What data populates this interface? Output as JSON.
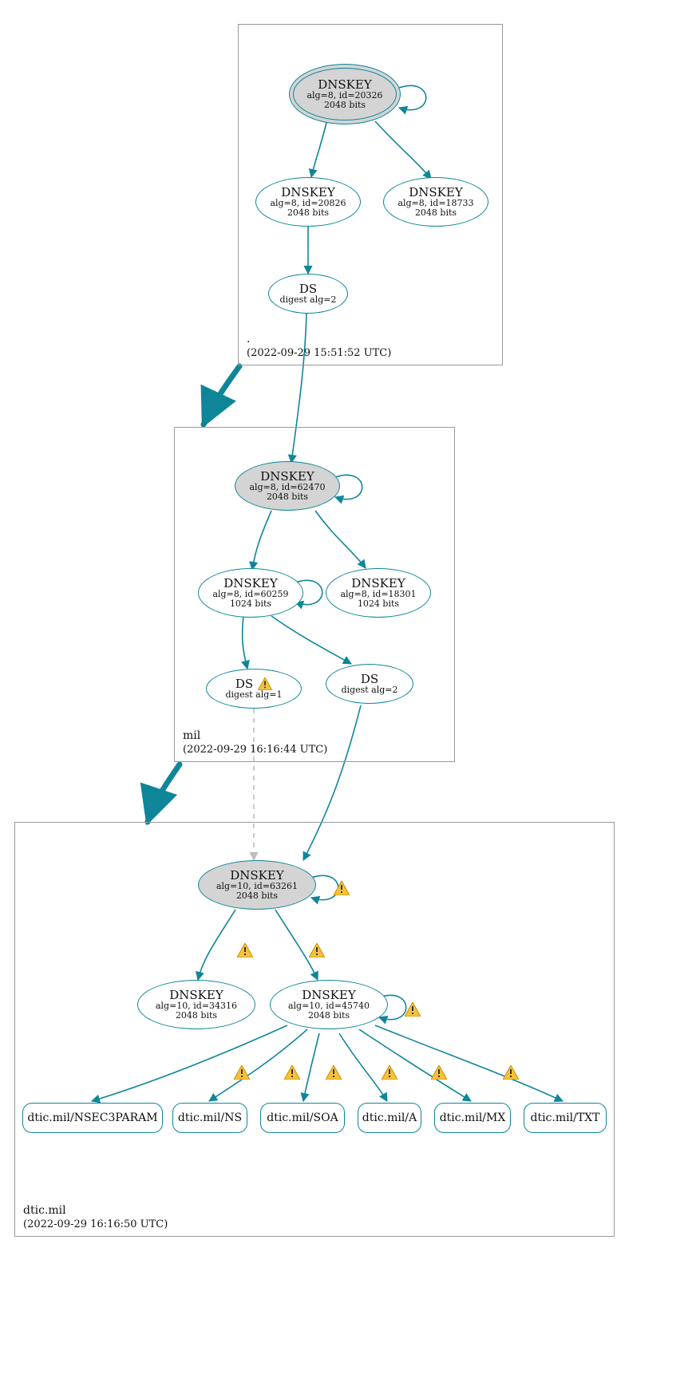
{
  "zones": {
    "root": {
      "name": ".",
      "timestamp": "(2022-09-29 15:51:52 UTC)"
    },
    "mil": {
      "name": "mil",
      "timestamp": "(2022-09-29 16:16:44 UTC)"
    },
    "dtic": {
      "name": "dtic.mil",
      "timestamp": "(2022-09-29 16:16:50 UTC)"
    }
  },
  "nodes": {
    "root_ksk": {
      "title": "DNSKEY",
      "sub1": "alg=8, id=20326",
      "sub2": "2048 bits"
    },
    "root_zsk": {
      "title": "DNSKEY",
      "sub1": "alg=8, id=20826",
      "sub2": "2048 bits"
    },
    "root_zsk2": {
      "title": "DNSKEY",
      "sub1": "alg=8, id=18733",
      "sub2": "2048 bits"
    },
    "root_ds": {
      "title": "DS",
      "sub1": "digest alg=2"
    },
    "mil_ksk": {
      "title": "DNSKEY",
      "sub1": "alg=8, id=62470",
      "sub2": "2048 bits"
    },
    "mil_zsk": {
      "title": "DNSKEY",
      "sub1": "alg=8, id=60259",
      "sub2": "1024 bits"
    },
    "mil_zsk2": {
      "title": "DNSKEY",
      "sub1": "alg=8, id=18301",
      "sub2": "1024 bits"
    },
    "mil_ds1": {
      "title": "DS",
      "sub1": "digest alg=1"
    },
    "mil_ds2": {
      "title": "DS",
      "sub1": "digest alg=2"
    },
    "dtic_ksk": {
      "title": "DNSKEY",
      "sub1": "alg=10, id=63261",
      "sub2": "2048 bits"
    },
    "dtic_zsk1": {
      "title": "DNSKEY",
      "sub1": "alg=10, id=34316",
      "sub2": "2048 bits"
    },
    "dtic_zsk2": {
      "title": "DNSKEY",
      "sub1": "alg=10, id=45740",
      "sub2": "2048 bits"
    }
  },
  "rr": {
    "nsec3": "dtic.mil/NSEC3PARAM",
    "ns": "dtic.mil/NS",
    "soa": "dtic.mil/SOA",
    "a": "dtic.mil/A",
    "mx": "dtic.mil/MX",
    "txt": "dtic.mil/TXT"
  },
  "colors": {
    "teal": "#0e8698"
  }
}
